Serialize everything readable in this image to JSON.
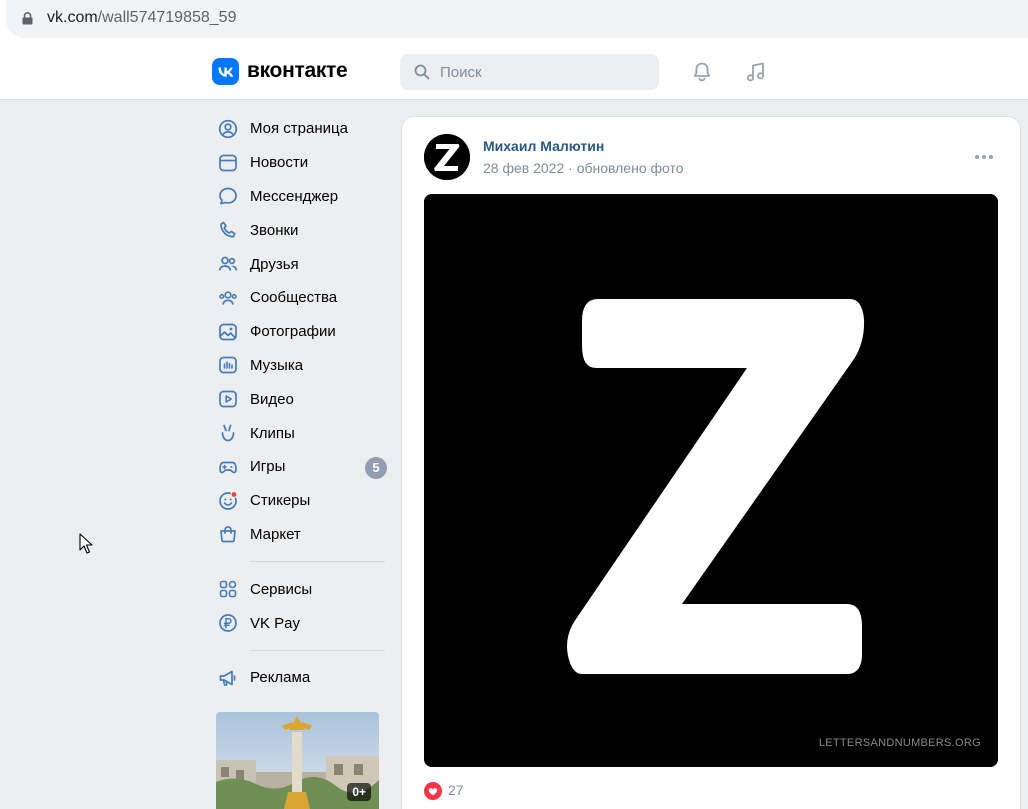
{
  "browser": {
    "url_host": "vk.com",
    "url_path": "/wall574719858_59"
  },
  "header": {
    "brand": "вконтакте",
    "search_placeholder": "Поиск"
  },
  "menu": {
    "items": [
      {
        "label": "Моя страница",
        "icon": "user-circle-icon"
      },
      {
        "label": "Новости",
        "icon": "news-icon"
      },
      {
        "label": "Мессенджер",
        "icon": "message-icon"
      },
      {
        "label": "Звонки",
        "icon": "phone-icon"
      },
      {
        "label": "Друзья",
        "icon": "friends-icon"
      },
      {
        "label": "Сообщества",
        "icon": "communities-icon"
      },
      {
        "label": "Фотографии",
        "icon": "photo-icon"
      },
      {
        "label": "Музыка",
        "icon": "music-icon"
      },
      {
        "label": "Видео",
        "icon": "video-icon"
      },
      {
        "label": "Клипы",
        "icon": "clips-icon"
      },
      {
        "label": "Игры",
        "icon": "gamepad-icon",
        "counter": "5"
      },
      {
        "label": "Стикеры",
        "icon": "sticker-icon"
      },
      {
        "label": "Маркет",
        "icon": "market-icon"
      }
    ],
    "extra_items": [
      {
        "label": "Сервисы",
        "icon": "services-icon"
      },
      {
        "label": "VK Pay",
        "icon": "vkpay-icon"
      }
    ],
    "ads_item": {
      "label": "Реклама",
      "icon": "megaphone-icon"
    },
    "promo_age": "0+"
  },
  "post": {
    "author": "Михаил Малютин",
    "date": "28 фев 2022",
    "action": "обновлено фото",
    "watermark": "LETTERSANDNUMBERS.ORG",
    "likes": "27"
  },
  "colors": {
    "link": "#2a5885",
    "accent": "#0077ff",
    "icon": "#447bba",
    "like": "#ff3347"
  }
}
